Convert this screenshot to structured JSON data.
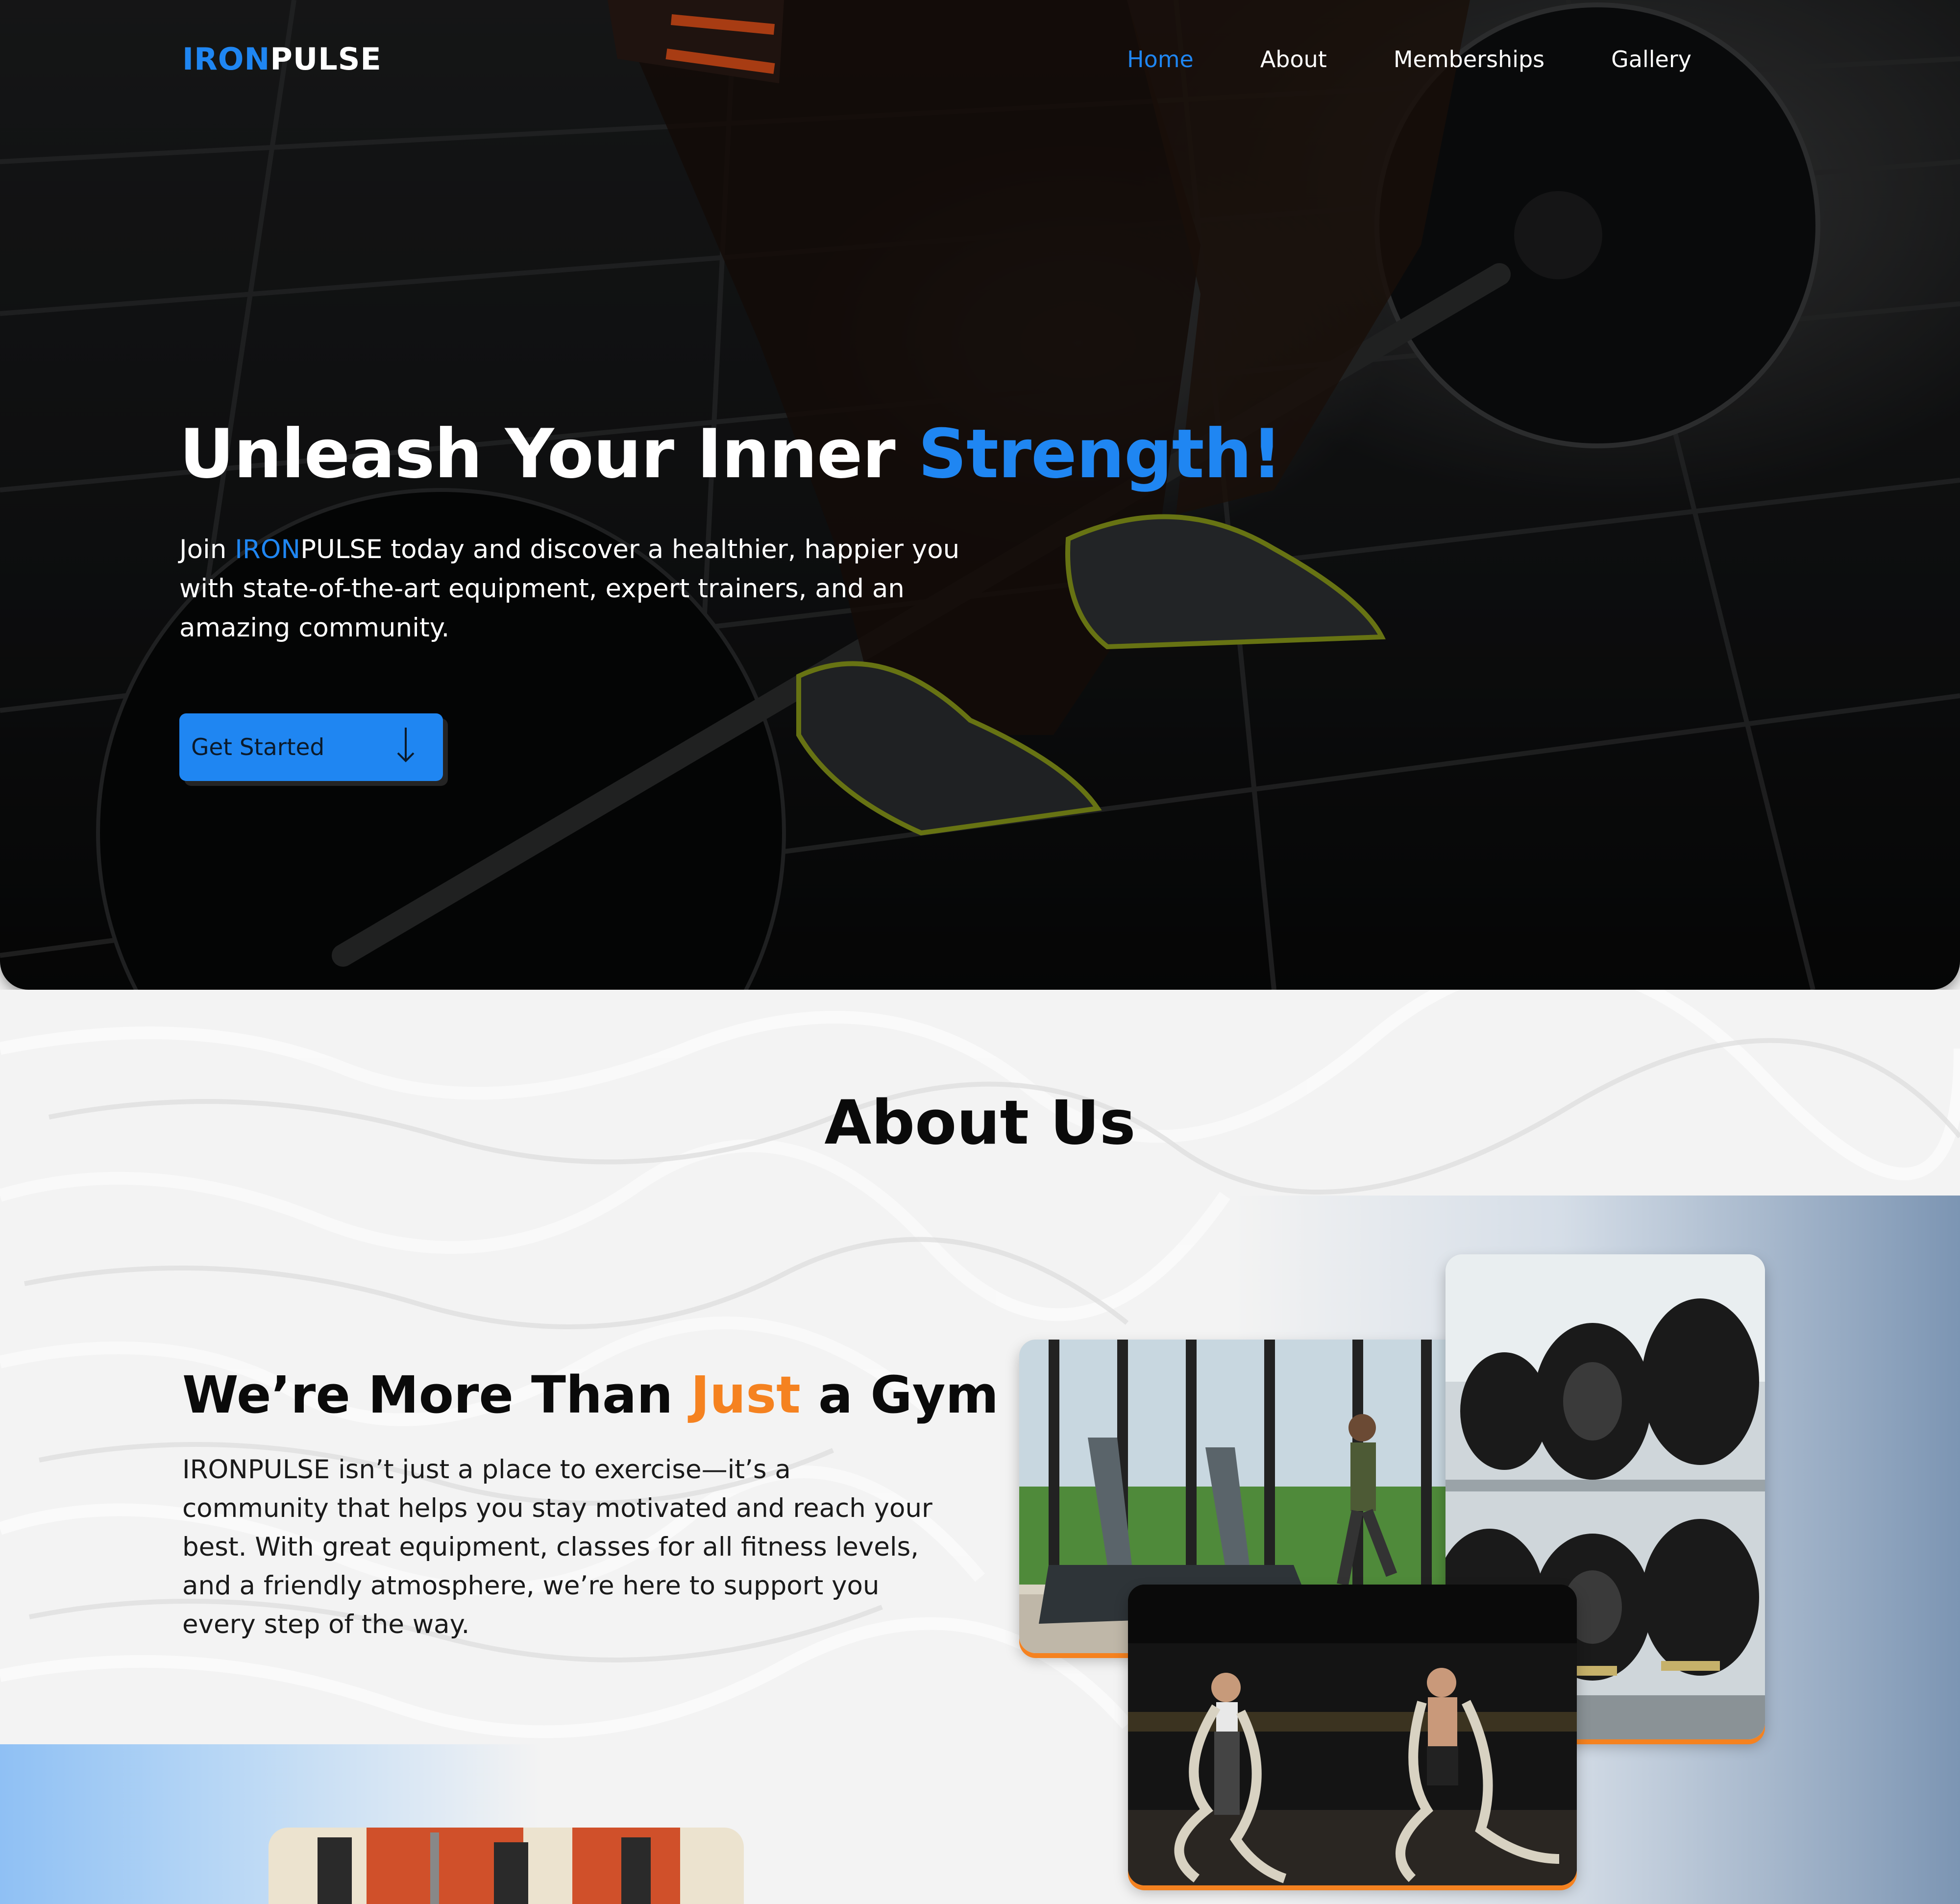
{
  "brand": {
    "part1": "IRON",
    "part2": "PULSE"
  },
  "nav": {
    "home": "Home",
    "about": "About",
    "memberships": "Memberships",
    "gallery": "Gallery"
  },
  "hero": {
    "title_main": "Unleash Your Inner ",
    "title_accent": "Strength!",
    "sub_before": "Join ",
    "sub_brand_blue": "IRON",
    "sub_brand_white": "PULSE",
    "sub_after": " today and discover a healthier, happier you with state-of-the-art equipment, expert trainers, and an amazing community.",
    "cta_label": "Get Started",
    "cta_icon": "arrow-down-icon"
  },
  "about": {
    "title": "About Us",
    "heading_before": "We’re More Than ",
    "heading_accent": "Just",
    "heading_after": " a Gym",
    "body": "IRONPULSE isn’t just a place to exercise—it’s a community that helps you stay motivated and reach your best. With great equipment, classes for all fitness levels, and a friendly atmosphere, we’re here to support you every step of the way."
  },
  "colors": {
    "accent_blue": "#1f86f2",
    "accent_orange": "#f58220",
    "hero_bg": "#111213"
  }
}
